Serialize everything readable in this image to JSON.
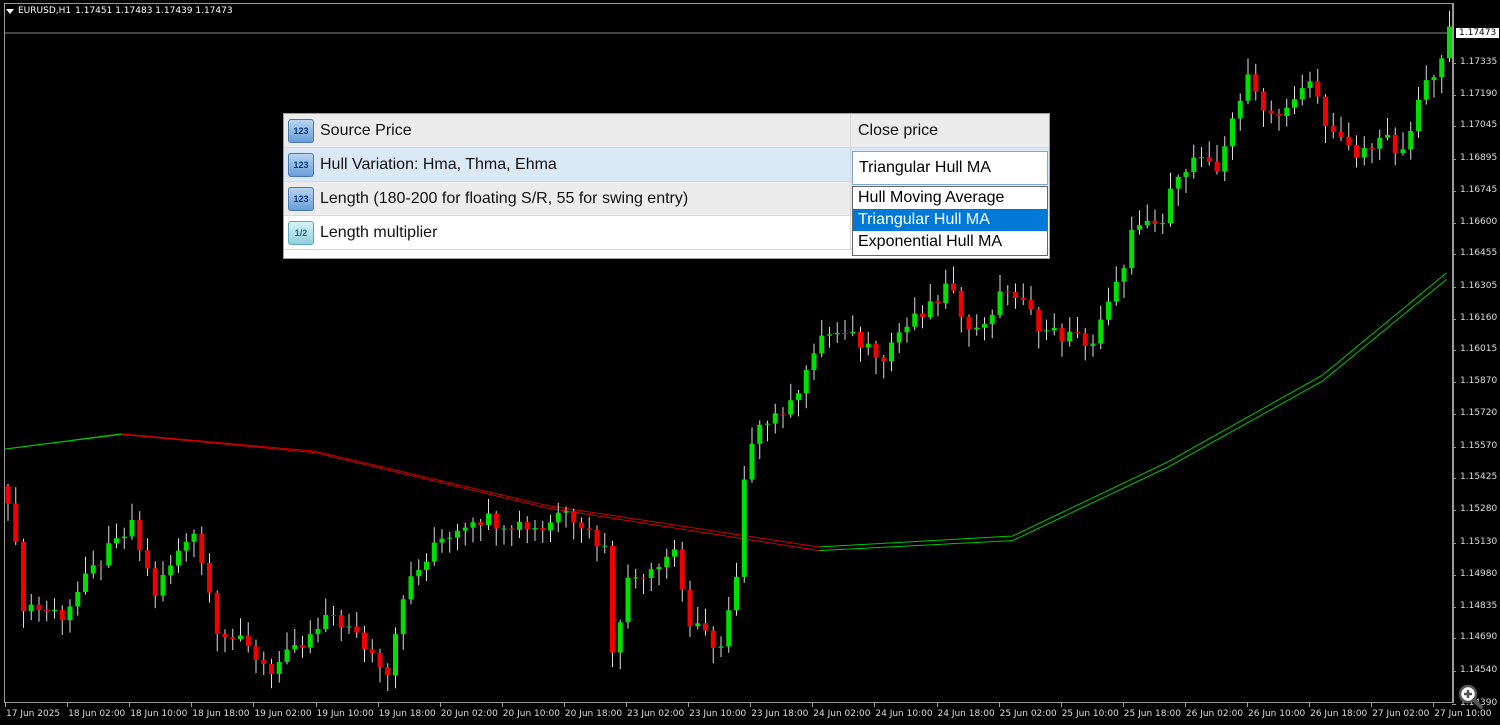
{
  "header": {
    "symbol": "EURUSD,H1",
    "ohlc": "1.17451 1.17483 1.17439 1.17473"
  },
  "price_axis": {
    "current_price": "1.17473",
    "labels": [
      "1.17335",
      "1.17190",
      "1.17045",
      "1.16895",
      "1.16745",
      "1.16600",
      "1.16455",
      "1.16305",
      "1.16160",
      "1.16015",
      "1.15870",
      "1.15720",
      "1.15570",
      "1.15425",
      "1.15280",
      "1.15130",
      "1.14980",
      "1.14835",
      "1.14690",
      "1.14540",
      "1.14390"
    ]
  },
  "time_axis": {
    "labels": [
      "17 Jun 2025",
      "18 Jun 02:00",
      "18 Jun 10:00",
      "18 Jun 18:00",
      "19 Jun 02:00",
      "19 Jun 10:00",
      "19 Jun 18:00",
      "20 Jun 02:00",
      "20 Jun 10:00",
      "20 Jun 18:00",
      "23 Jun 02:00",
      "23 Jun 10:00",
      "23 Jun 18:00",
      "24 Jun 02:00",
      "24 Jun 10:00",
      "24 Jun 18:00",
      "25 Jun 02:00",
      "25 Jun 10:00",
      "25 Jun 18:00",
      "26 Jun 02:00",
      "26 Jun 10:00",
      "26 Jun 18:00",
      "27 Jun 02:00",
      "27 Jun 10:00"
    ]
  },
  "colors": {
    "bull": "#00e000",
    "bear": "#f00000",
    "ma_up": "#00c800",
    "ma_down": "#d00000",
    "selection": "#0078d7"
  },
  "dialog": {
    "rows": [
      {
        "icon": "123",
        "name": "Source Price",
        "value": "Close price"
      },
      {
        "icon": "123",
        "name": "Hull Variation: Hma, Thma, Ehma",
        "value": ""
      },
      {
        "icon": "123",
        "name": "Length (180-200 for floating S/R, 55 for swing entry)",
        "value": ""
      },
      {
        "icon": "1/2",
        "name": "Length multiplier",
        "value": ""
      }
    ],
    "combo_value": "Triangular Hull MA",
    "options": [
      "Hull Moving Average",
      "Triangular Hull MA",
      "Exponential Hull MA"
    ],
    "selected_option": 1
  },
  "chart_data": {
    "type": "candlestick",
    "title": "EURUSD,H1",
    "bars": 187,
    "ylim": [
      1.1436,
      1.1752
    ],
    "close_keypoints": [
      [
        0,
        1.1535
      ],
      [
        2,
        1.1485
      ],
      [
        7,
        1.148
      ],
      [
        12,
        1.1505
      ],
      [
        16,
        1.152
      ],
      [
        19,
        1.149
      ],
      [
        24,
        1.152
      ],
      [
        27,
        1.1475
      ],
      [
        34,
        1.1455
      ],
      [
        38,
        1.1465
      ],
      [
        42,
        1.148
      ],
      [
        49,
        1.1455
      ],
      [
        51,
        1.149
      ],
      [
        56,
        1.1515
      ],
      [
        60,
        1.1525
      ],
      [
        69,
        1.152
      ],
      [
        72,
        1.153
      ],
      [
        77,
        1.151
      ],
      [
        78,
        1.1465
      ],
      [
        80,
        1.1495
      ],
      [
        86,
        1.151
      ],
      [
        88,
        1.1475
      ],
      [
        92,
        1.1465
      ],
      [
        94,
        1.1495
      ],
      [
        95,
        1.154
      ],
      [
        97,
        1.157
      ],
      [
        101,
        1.1575
      ],
      [
        103,
        1.1595
      ],
      [
        106,
        1.161
      ],
      [
        110,
        1.1605
      ],
      [
        113,
        1.16
      ],
      [
        115,
        1.161
      ],
      [
        119,
        1.162
      ],
      [
        121,
        1.163
      ],
      [
        125,
        1.161
      ],
      [
        129,
        1.163
      ],
      [
        134,
        1.161
      ],
      [
        140,
        1.1605
      ],
      [
        143,
        1.163
      ],
      [
        145,
        1.1655
      ],
      [
        149,
        1.166
      ],
      [
        151,
        1.1685
      ],
      [
        154,
        1.169
      ],
      [
        156,
        1.168
      ],
      [
        158,
        1.171
      ],
      [
        160,
        1.1725
      ],
      [
        163,
        1.171
      ],
      [
        166,
        1.1715
      ],
      [
        168,
        1.1725
      ],
      [
        171,
        1.17
      ],
      [
        174,
        1.169
      ],
      [
        177,
        1.17
      ],
      [
        180,
        1.169
      ],
      [
        182,
        1.1715
      ],
      [
        186,
        1.1747
      ]
    ],
    "hull_ma_keypoints": [
      [
        0,
        1.1556
      ],
      [
        15,
        1.1563
      ],
      [
        40,
        1.1555
      ],
      [
        70,
        1.153
      ],
      [
        105,
        1.1511
      ],
      [
        130,
        1.1516
      ],
      [
        150,
        1.155
      ],
      [
        170,
        1.159
      ],
      [
        186,
        1.1637
      ]
    ],
    "hull_ma_offset": -0.0003
  }
}
